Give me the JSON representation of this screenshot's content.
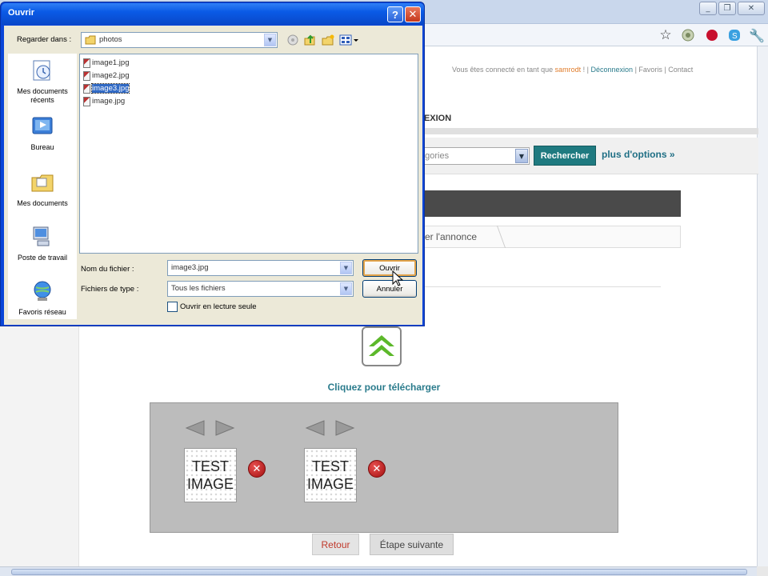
{
  "browser": {
    "window_buttons": [
      "_",
      "❐",
      "✕"
    ],
    "toolbar_icons": [
      "star-icon",
      "extension-icon",
      "record-icon",
      "skype-icon",
      "wrench-icon"
    ]
  },
  "site": {
    "header": {
      "connected_text": "Vous êtes connecté en tant que",
      "username": "samrodt",
      "logout": "Déconnexion",
      "favorites": "Favoris",
      "contact": "Contact"
    },
    "nav_partial": "NEXION",
    "search": {
      "category_value": "égories",
      "search_button": "Rechercher",
      "more_options": "plus d'options »"
    },
    "step_tab_text": "fier l'annonce",
    "upload_label": "Cliquez pour télécharger",
    "images": [
      {
        "line1": "TEST",
        "line2": "IMAGE"
      },
      {
        "line1": "TEST",
        "line2": "IMAGE"
      }
    ],
    "buttons": {
      "back": "Retour",
      "next": "Étape suivante"
    }
  },
  "dialog": {
    "title": "Ouvrir",
    "help": "?",
    "close": "✕",
    "look_in_label": "Regarder dans :",
    "look_in_value": "photos",
    "places": [
      "Mes documents récents",
      "Bureau",
      "Mes documents",
      "Poste de travail",
      "Favoris réseau"
    ],
    "files": [
      "image1.jpg",
      "image2.jpg",
      "image3.jpg",
      "image.jpg"
    ],
    "selected_file_index": 2,
    "filename_label": "Nom du fichier :",
    "filename_value": "image3.jpg",
    "filetype_label": "Fichiers de type :",
    "filetype_value": "Tous les fichiers",
    "readonly_label": "Ouvrir en lecture seule",
    "open_button": "Ouvrir",
    "cancel_button": "Annuler"
  }
}
